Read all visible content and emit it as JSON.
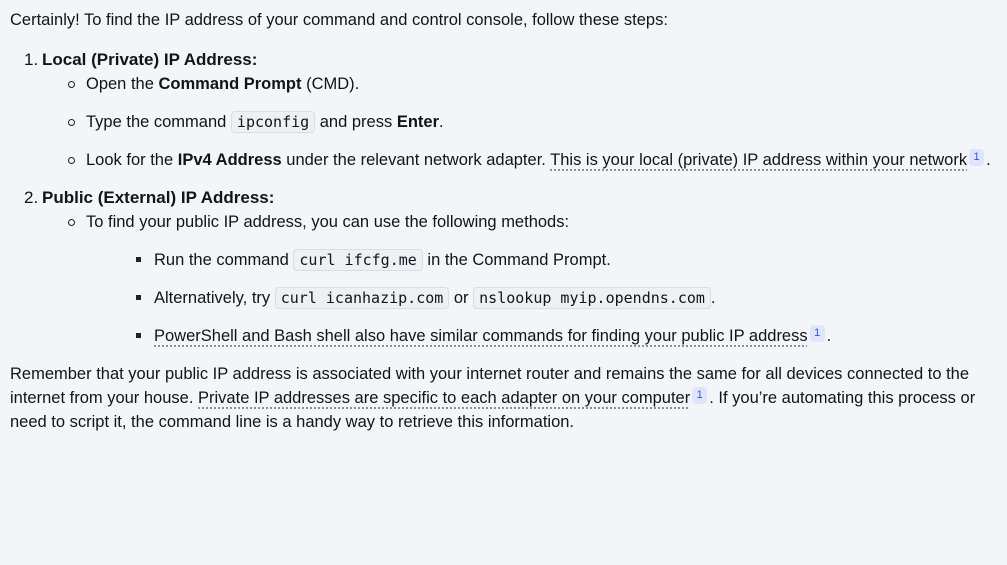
{
  "intro": "Certainly! To find the IP address of your command and control console, follow these steps:",
  "steps": [
    {
      "number": "1.",
      "title": "Local (Private) IP Address:",
      "items": [
        {
          "pre": "Open the ",
          "bold": "Command Prompt",
          "post": " (CMD)."
        },
        {
          "pre": "Type the command ",
          "code": "ipconfig",
          "mid": " and press ",
          "bold": "Enter",
          "post": "."
        },
        {
          "pre": "Look for the ",
          "bold": "IPv4 Address",
          "mid": " under the relevant network adapter. ",
          "cite_text": "This is your local (private) IP address within your network",
          "badge": "1",
          "post": "."
        }
      ]
    },
    {
      "number": "2.",
      "title": "Public (External) IP Address:",
      "item": "To find your public IP address, you can use the following methods:",
      "subitems": [
        {
          "pre": "Run the command ",
          "code": "curl ifcfg.me",
          "post": " in the Command Prompt."
        },
        {
          "pre": "Alternatively, try ",
          "code1": "curl icanhazip.com",
          "mid": " or ",
          "code2": "nslookup myip.opendns.com",
          "post": "."
        },
        {
          "cite_text": "PowerShell and Bash shell also have similar commands for finding your public IP address",
          "badge": "1",
          "post": "."
        }
      ]
    }
  ],
  "outro": {
    "pre": "Remember that your public IP address is associated with your internet router and remains the same for all devices connected to the internet from your house. ",
    "cite_text": "Private IP addresses are specific to each adapter on your computer",
    "badge": "1",
    "post": ". If you’re automating this process or need to script it, the command line is a handy way to retrieve this information."
  }
}
